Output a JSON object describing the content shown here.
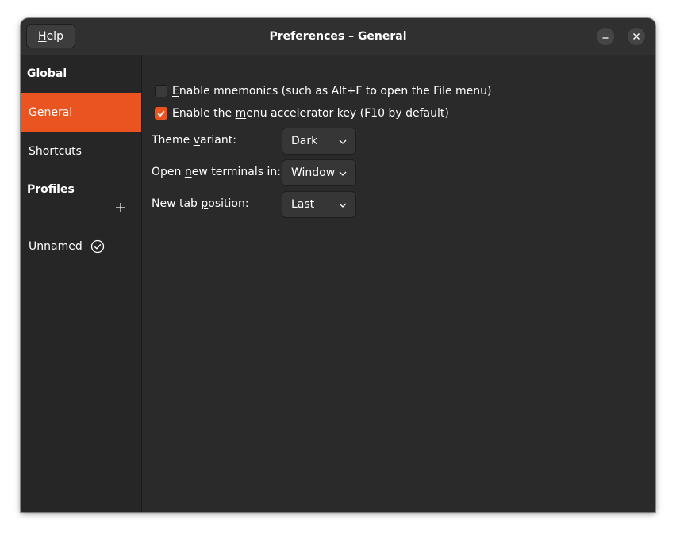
{
  "window": {
    "title": "Preferences – General",
    "help_label_prefix": "",
    "help_label_mnemonic": "H",
    "help_label_rest": "elp",
    "accent_color": "#e95420"
  },
  "sidebar": {
    "global_header": "Global",
    "items": [
      {
        "label": "General",
        "active": true
      },
      {
        "label": "Shortcuts",
        "active": false
      }
    ],
    "profiles_header": "Profiles",
    "profiles": [
      {
        "label": "Unnamed",
        "default": true
      }
    ]
  },
  "general": {
    "mnemonics": {
      "checked": false,
      "label_mnemonic": "E",
      "label_rest": "nable mnemonics (such as Alt+F to open the File menu)"
    },
    "menu_accel": {
      "checked": true,
      "label_pre": "Enable the ",
      "label_mnemonic": "m",
      "label_rest": "enu accelerator key (F10 by default)"
    },
    "theme_variant": {
      "label_pre": "Theme ",
      "label_mnemonic": "v",
      "label_rest": "ariant:",
      "value": "Dark"
    },
    "new_terminals": {
      "label_pre": "Open ",
      "label_mnemonic": "n",
      "label_rest": "ew terminals in:",
      "value": "Window"
    },
    "tab_position": {
      "label_pre": "New tab ",
      "label_mnemonic": "p",
      "label_rest": "osition:",
      "value": "Last"
    }
  }
}
